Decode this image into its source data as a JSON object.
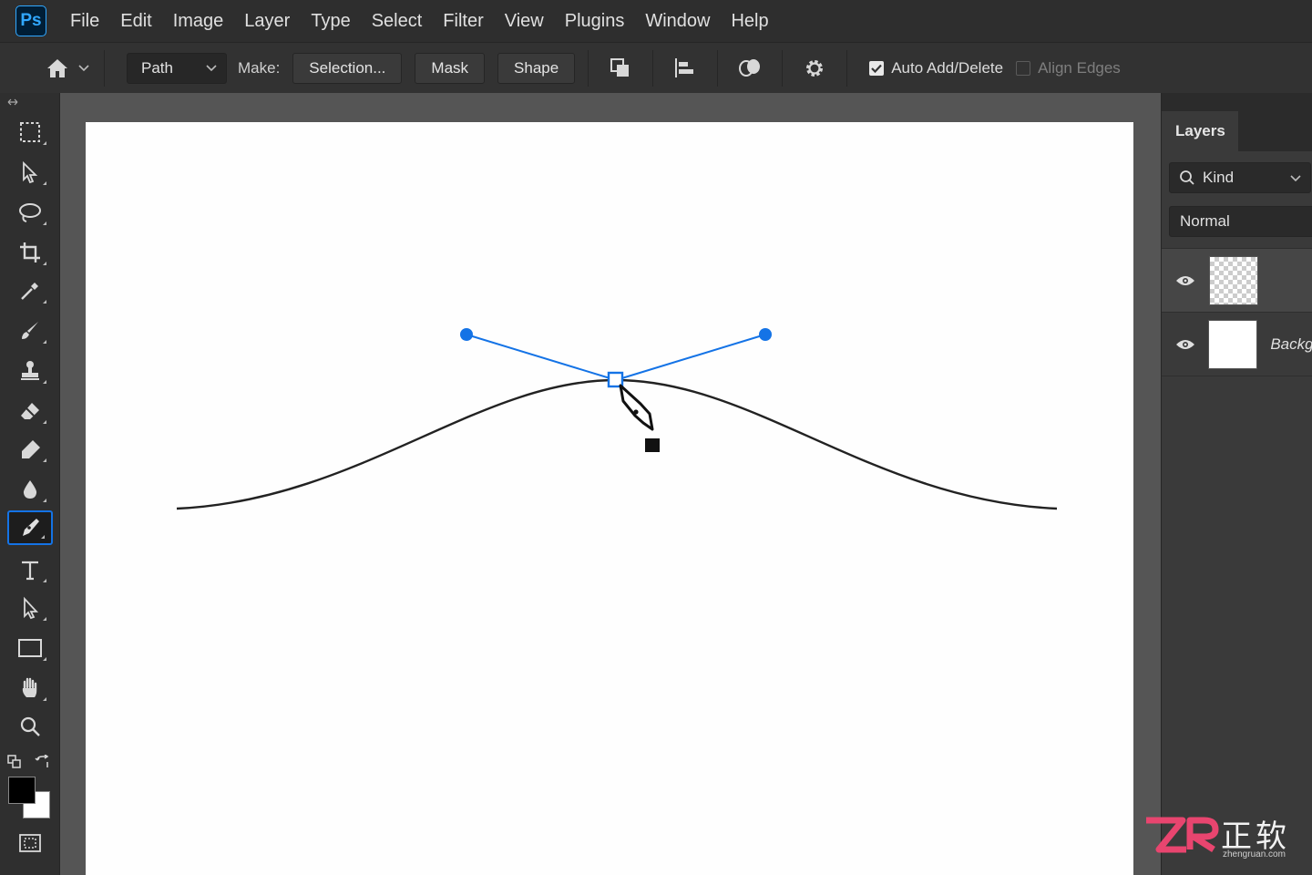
{
  "app": {
    "logo_text": "Ps"
  },
  "menu": [
    "File",
    "Edit",
    "Image",
    "Layer",
    "Type",
    "Select",
    "Filter",
    "View",
    "Plugins",
    "Window",
    "Help"
  ],
  "options_bar": {
    "mode_value": "Path",
    "make_label": "Make:",
    "selection_label": "Selection...",
    "mask_label": "Mask",
    "shape_label": "Shape",
    "auto_add_delete": {
      "label": "Auto Add/Delete",
      "checked": true
    },
    "align_edges": {
      "label": "Align Edges",
      "checked": false
    }
  },
  "toolbar": {
    "tools": [
      "marquee-tool",
      "artboard-move-tool",
      "lasso-tool",
      "crop-tool",
      "eyedropper-tool",
      "brush-tool",
      "clone-stamp-tool",
      "eraser-tool",
      "gradient-tool",
      "blur-tool",
      "pen-tool",
      "type-tool",
      "path-selection-tool",
      "rectangle-tool",
      "hand-tool",
      "zoom-tool"
    ],
    "active_tool": "pen-tool",
    "foreground_color": "#000000",
    "background_color": "#ffffff"
  },
  "canvas": {
    "curve_color": "#222222",
    "handle_color": "#1473e6"
  },
  "layers_panel": {
    "tab_label": "Layers",
    "filter_label": "Kind",
    "blend_mode": "Normal",
    "layers": [
      {
        "name": "",
        "thumbnail": "transparent",
        "visible": true,
        "selected": true
      },
      {
        "name": "Backg",
        "thumbnail": "white",
        "visible": true,
        "selected": false
      }
    ]
  },
  "watermark": {
    "brand": "ZR",
    "cn_text": "正软",
    "url_text": "zhengruan.com"
  },
  "colors": {
    "accent": "#1473e6",
    "menubar_bg": "#2e2e2e",
    "panel_bg": "#3a3a3a"
  }
}
